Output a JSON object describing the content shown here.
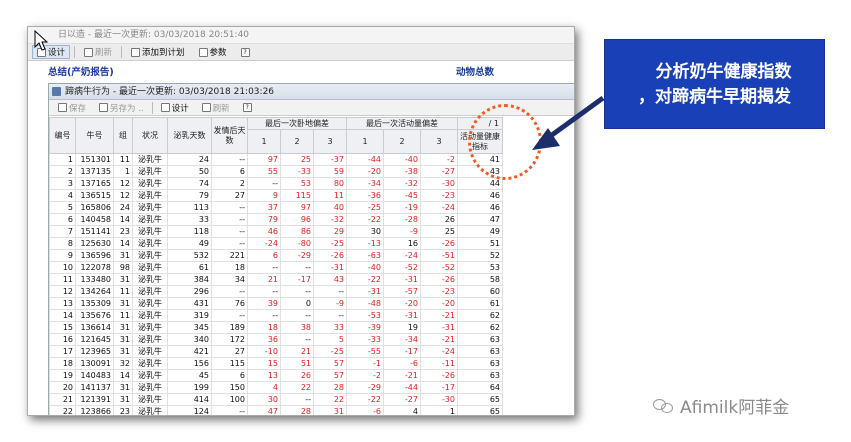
{
  "window": {
    "title": "日以造 - 最近一次更新: 03/03/2018 20:51:40"
  },
  "toolbar": {
    "design_label": "设计",
    "refresh_label": "刷新",
    "add_to_plan_label": "添加到计划",
    "params_label": "参数",
    "help_label": "?"
  },
  "summary": {
    "left_title": "总结(产奶报告)",
    "right_title": "动物总数"
  },
  "inner": {
    "title": "蹄病牛行为 - 最近一次更新: 03/03/2018 21:03:26",
    "save_label": "保存",
    "save_as_label": "另存为 ..",
    "design_label": "设计",
    "refresh_label": "刷新",
    "help_label": "?"
  },
  "table": {
    "group1_header": "最后一次卧地偏差",
    "group2_header": "最后一次活动量偏差",
    "last_header_top": "/ 1",
    "columns": [
      "编号",
      "牛号",
      "组",
      "状况",
      "泌乳天数",
      "发情后天数",
      "1",
      "2",
      "3",
      "1",
      "2",
      "3",
      "活动量健康指标"
    ],
    "rows": [
      [
        "1",
        "151301",
        "11",
        "泌乳牛",
        "24",
        "--",
        "97",
        "25",
        "-37",
        "-44",
        "-40",
        "-2",
        "41"
      ],
      [
        "2",
        "137135",
        "1",
        "泌乳牛",
        "50",
        "6",
        "55",
        "-33",
        "59",
        "-20",
        "-38",
        "-27",
        "43"
      ],
      [
        "3",
        "137165",
        "12",
        "泌乳牛",
        "74",
        "2",
        "--",
        "53",
        "80",
        "-34",
        "-32",
        "-30",
        "44"
      ],
      [
        "4",
        "136515",
        "12",
        "泌乳牛",
        "79",
        "27",
        "9",
        "115",
        "11",
        "-36",
        "-45",
        "-23",
        "46"
      ],
      [
        "5",
        "165806",
        "24",
        "泌乳牛",
        "113",
        "--",
        "37",
        "97",
        "40",
        "-25",
        "-19",
        "-24",
        "46"
      ],
      [
        "6",
        "140458",
        "14",
        "泌乳牛",
        "33",
        "--",
        "79",
        "96",
        "-32",
        "-22",
        "-28",
        "26",
        "47"
      ],
      [
        "7",
        "151141",
        "23",
        "泌乳牛",
        "118",
        "--",
        "46",
        "86",
        "29",
        "30",
        "-9",
        "25",
        "49"
      ],
      [
        "8",
        "125630",
        "14",
        "泌乳牛",
        "49",
        "--",
        "-24",
        "-80",
        "-25",
        "-13",
        "16",
        "-26",
        "51"
      ],
      [
        "9",
        "136596",
        "31",
        "泌乳牛",
        "532",
        "221",
        "6",
        "-29",
        "-26",
        "-63",
        "-24",
        "-51",
        "52"
      ],
      [
        "10",
        "122078",
        "98",
        "泌乳牛",
        "61",
        "18",
        "--",
        "--",
        "-31",
        "-40",
        "-52",
        "-52",
        "53"
      ],
      [
        "11",
        "133480",
        "31",
        "泌乳牛",
        "384",
        "34",
        "21",
        "-17",
        "43",
        "-22",
        "-31",
        "-26",
        "58"
      ],
      [
        "12",
        "134264",
        "11",
        "泌乳牛",
        "296",
        "--",
        "--",
        "--",
        "--",
        "-31",
        "-57",
        "-23",
        "60"
      ],
      [
        "13",
        "135309",
        "31",
        "泌乳牛",
        "431",
        "76",
        "39",
        "0",
        "-9",
        "-48",
        "-20",
        "-20",
        "61"
      ],
      [
        "14",
        "135676",
        "11",
        "泌乳牛",
        "319",
        "--",
        "--",
        "--",
        "--",
        "-53",
        "-31",
        "-21",
        "62"
      ],
      [
        "15",
        "136614",
        "31",
        "泌乳牛",
        "345",
        "189",
        "18",
        "38",
        "33",
        "-39",
        "19",
        "-31",
        "62"
      ],
      [
        "16",
        "121645",
        "31",
        "泌乳牛",
        "340",
        "172",
        "36",
        "--",
        "5",
        "-33",
        "-34",
        "-21",
        "63"
      ],
      [
        "17",
        "123965",
        "31",
        "泌乳牛",
        "421",
        "27",
        "-10",
        "21",
        "-25",
        "-55",
        "-17",
        "-24",
        "63"
      ],
      [
        "18",
        "130091",
        "32",
        "泌乳牛",
        "156",
        "115",
        "15",
        "51",
        "57",
        "-1",
        "-6",
        "-11",
        "63"
      ],
      [
        "19",
        "140483",
        "14",
        "泌乳牛",
        "45",
        "6",
        "13",
        "26",
        "57",
        "-2",
        "-21",
        "-26",
        "63"
      ],
      [
        "20",
        "141137",
        "31",
        "泌乳牛",
        "199",
        "150",
        "4",
        "22",
        "28",
        "-29",
        "-44",
        "-17",
        "64"
      ],
      [
        "21",
        "121391",
        "31",
        "泌乳牛",
        "414",
        "100",
        "30",
        "--",
        "22",
        "-22",
        "-27",
        "-30",
        "65"
      ],
      [
        "22",
        "123866",
        "23",
        "泌乳牛",
        "124",
        "--",
        "47",
        "28",
        "31",
        "-6",
        "4",
        "1",
        "65"
      ]
    ]
  },
  "callout": {
    "line1": "分析奶牛健康指数",
    "line2": "，对蹄病牛早期揭发"
  },
  "watermark": {
    "text": "Afimilk阿菲金"
  },
  "colors": {
    "callout_bg": "#1a40b8",
    "negative": "#e02020",
    "header_blue": "#1a3b9a",
    "circle": "#f25a20"
  }
}
